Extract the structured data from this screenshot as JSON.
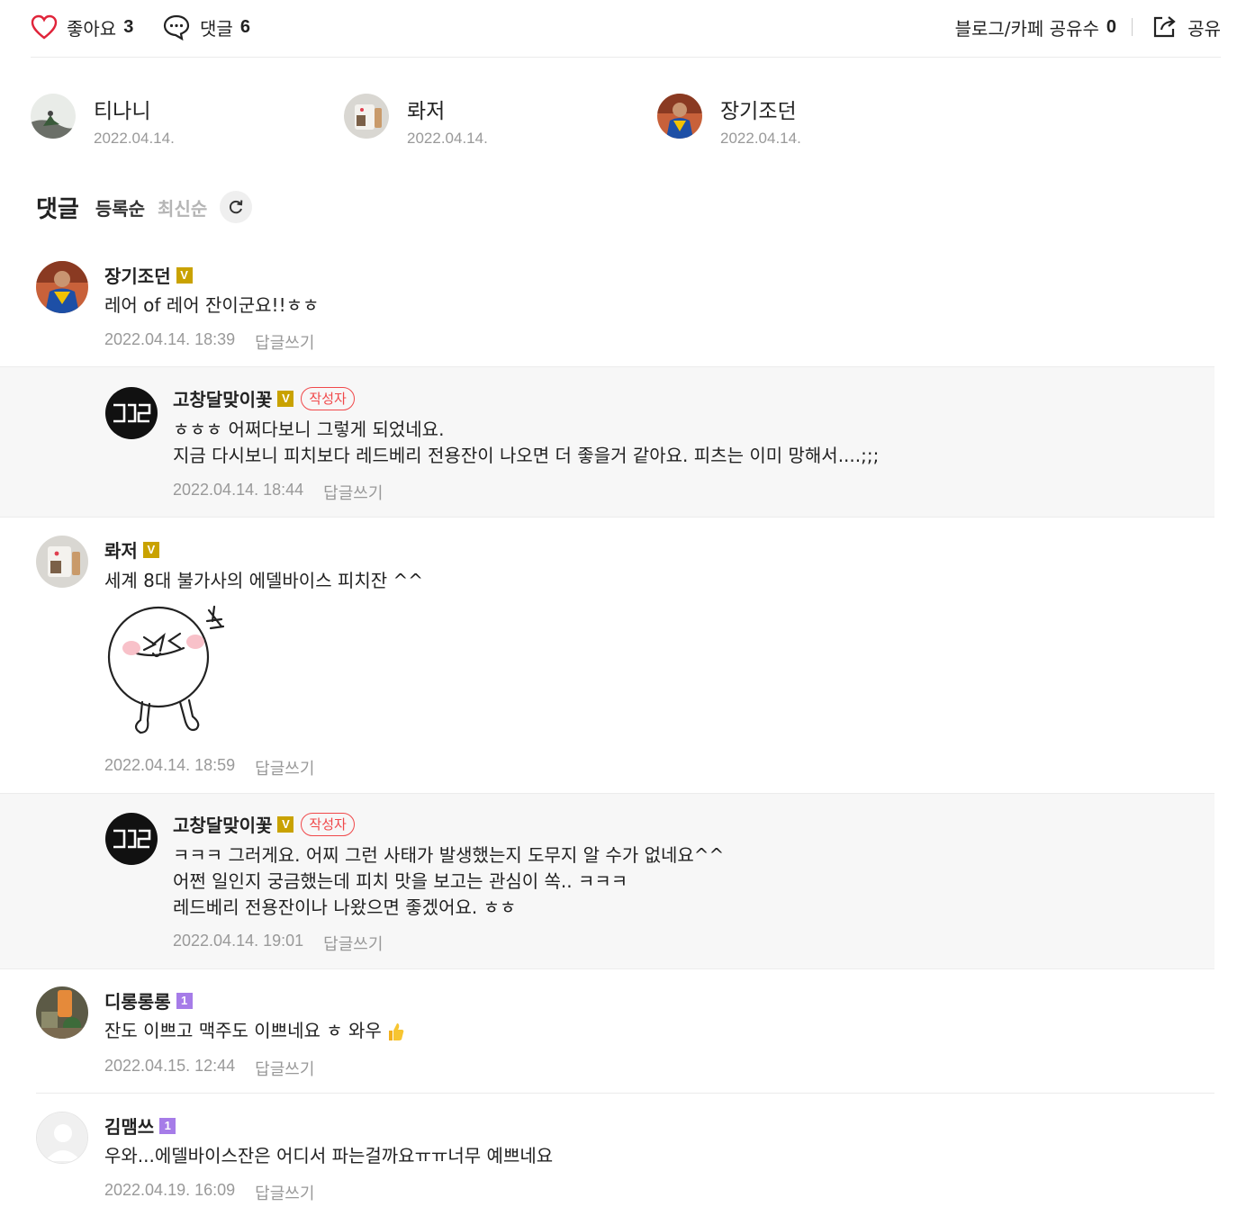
{
  "topbar": {
    "like_label": "좋아요",
    "like_count": "3",
    "comment_label": "댓글",
    "comment_count": "6",
    "share_count_label": "블로그/카페 공유수",
    "share_count": "0",
    "share_label": "공유"
  },
  "likers": [
    {
      "name": "티나니",
      "date": "2022.04.14."
    },
    {
      "name": "롸저",
      "date": "2022.04.14."
    },
    {
      "name": "장기조던",
      "date": "2022.04.14."
    }
  ],
  "comments_header": {
    "title": "댓글",
    "sort_registered": "등록순",
    "sort_latest": "최신순"
  },
  "comments": [
    {
      "author": "장기조던",
      "badge": "V",
      "text": "레어 of 레어 잔이군요!!ㅎㅎ",
      "time": "2022.04.14. 18:39",
      "reply_label": "답글쓰기"
    },
    {
      "author": "고창달맞이꽃",
      "badge": "V",
      "author_badge": "작성자",
      "text": "ㅎㅎㅎ 어쩌다보니 그렇게 되었네요.\n지금 다시보니 피치보다 레드베리 전용잔이 나오면 더 좋을거 같아요. 피츠는 이미 망해서....;;;",
      "time": "2022.04.14. 18:44",
      "reply_label": "답글쓰기"
    },
    {
      "author": "롸저",
      "badge": "V",
      "text": "세계 8대 불가사의 에델바이스 피치잔 ^^",
      "time": "2022.04.14. 18:59",
      "reply_label": "답글쓰기"
    },
    {
      "author": "고창달맞이꽃",
      "badge": "V",
      "author_badge": "작성자",
      "text": "ㅋㅋㅋ 그러게요. 어찌 그런 사태가 발생했는지 도무지 알 수가 없네요^^\n어쩐 일인지 궁금했는데 피치 맛을 보고는 관심이 쏙.. ㅋㅋㅋ\n레드베리 전용잔이나 나왔으면 좋겠어요. ㅎㅎ",
      "time": "2022.04.14. 19:01",
      "reply_label": "답글쓰기"
    },
    {
      "author": "디롱롱롱",
      "badge": "1",
      "text": "잔도 이쁘고 맥주도 이쁘네요 ㅎ 와우",
      "time": "2022.04.15. 12:44",
      "reply_label": "답글쓰기"
    },
    {
      "author": "김맴쓰",
      "badge": "1",
      "text": "우와...에델바이스잔은 어디서 파는걸까요ㅠㅠ너무 예쁘네요",
      "time": "2022.04.19. 16:09",
      "reply_label": "답글쓰기"
    }
  ],
  "colors": {
    "like_icon": "#e0243a",
    "author_badge": "#f0484a",
    "badge_v": "#c9a200",
    "badge_1": "#a67ce8",
    "reply_bg": "#f7f7f7"
  },
  "icons": [
    "heart-icon",
    "comment-bubble-icon",
    "share-icon",
    "refresh-icon",
    "thumbs-up-icon"
  ]
}
